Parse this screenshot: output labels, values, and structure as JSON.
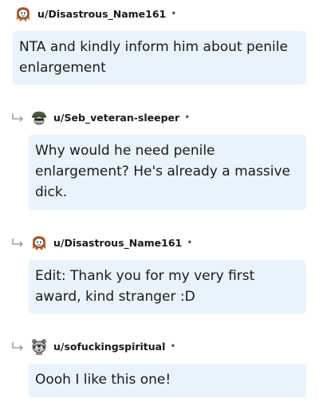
{
  "comments": [
    {
      "username": "u/Disastrous_Name161",
      "separator": "•",
      "avatar_icon": "snoo-avatar-redhead-icon",
      "text": "NTA and kindly inform him about penile enlargement",
      "is_reply": false
    },
    {
      "username": "u/Seb_veteran-sleeper",
      "separator": "•",
      "avatar_icon": "snoo-avatar-helmet-icon",
      "text": "Why would he need penile enlargement? He's already a massive dick.",
      "is_reply": true
    },
    {
      "username": "u/Disastrous_Name161",
      "separator": "•",
      "avatar_icon": "snoo-avatar-redhead-icon",
      "text": "Edit: Thank you for my very first award, kind stranger :D",
      "is_reply": true
    },
    {
      "username": "u/sofuckingspiritual",
      "separator": "•",
      "avatar_icon": "snoo-avatar-raccoon-icon",
      "text": "Oooh I like this one!",
      "is_reply": true
    }
  ],
  "colors": {
    "bubble": "#e8f3fb",
    "text": "#1a1a1b",
    "reply_arrow": "#9aa0a6"
  }
}
